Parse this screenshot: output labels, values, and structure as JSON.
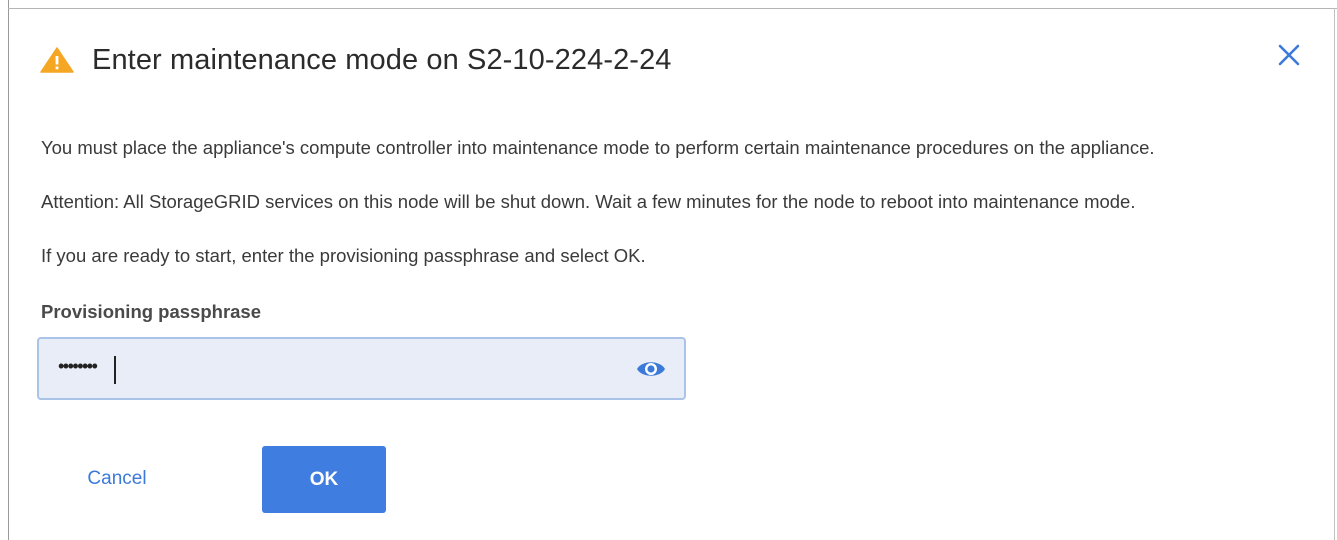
{
  "dialog": {
    "title": "Enter maintenance mode on S2-10-224-2-24",
    "title_icon": "warning-icon",
    "close_icon": "close-icon",
    "paragraphs": [
      "You must place the appliance's compute controller into maintenance mode to perform certain maintenance procedures on the appliance.",
      "Attention: All StorageGRID services on this node will be shut down. Wait a few minutes for the node to reboot into maintenance mode.",
      "If you are ready to start, enter the provisioning passphrase and select OK."
    ]
  },
  "passphrase": {
    "label": "Provisioning passphrase",
    "value": "••••••••",
    "toggle_icon": "eye-icon"
  },
  "actions": {
    "cancel_label": "Cancel",
    "ok_label": "OK"
  },
  "colors": {
    "accent": "#3f7ee0",
    "warning": "#f5a623",
    "link": "#3c7ad9",
    "field_bg": "#e8edf7",
    "field_border": "#a9c4e8"
  }
}
